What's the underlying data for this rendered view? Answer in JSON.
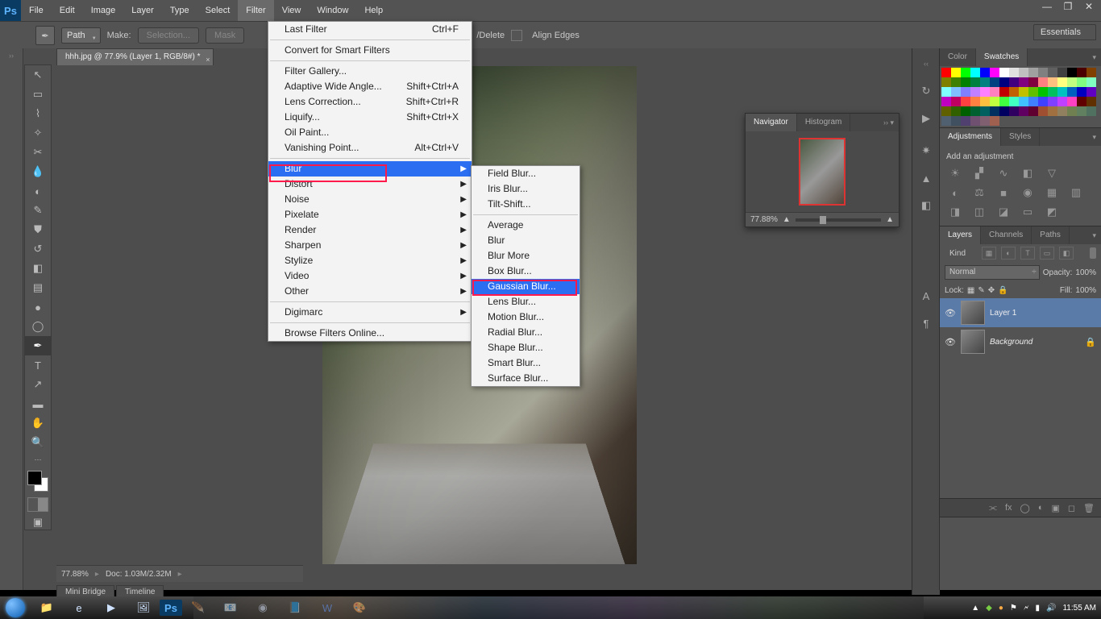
{
  "app": {
    "logo": "Ps"
  },
  "menu": {
    "items": [
      "File",
      "Edit",
      "Image",
      "Layer",
      "Type",
      "Select",
      "Filter",
      "View",
      "Window",
      "Help"
    ],
    "open_index": 6
  },
  "window_controls": {
    "min": "—",
    "max": "❐",
    "close": "✕"
  },
  "options_bar": {
    "mode": "Path",
    "make_label": "Make:",
    "btn_selection": "Selection...",
    "btn_mask": "Mask",
    "align_ops": "/Delete",
    "align_edges": "Align Edges",
    "essentials": "Essentials"
  },
  "document": {
    "tab": "hhh.jpg @ 77.9% (Layer 1, RGB/8#) *",
    "zoom": "77.88%",
    "doc_size": "Doc:  1.03M/2.32M"
  },
  "bridge_tabs": {
    "mini": "Mini Bridge",
    "timeline": "Timeline"
  },
  "filter_menu": {
    "items": [
      {
        "label": "Last Filter",
        "shortcut": "Ctrl+F"
      },
      {
        "sep": true
      },
      {
        "label": "Convert for Smart Filters"
      },
      {
        "sep": true
      },
      {
        "label": "Filter Gallery..."
      },
      {
        "label": "Adaptive Wide Angle...",
        "shortcut": "Shift+Ctrl+A"
      },
      {
        "label": "Lens Correction...",
        "shortcut": "Shift+Ctrl+R"
      },
      {
        "label": "Liquify...",
        "shortcut": "Shift+Ctrl+X"
      },
      {
        "label": "Oil Paint..."
      },
      {
        "label": "Vanishing Point...",
        "shortcut": "Alt+Ctrl+V"
      },
      {
        "sep": true
      },
      {
        "label": "Blur",
        "sub": true,
        "hl": true
      },
      {
        "label": "Distort",
        "sub": true
      },
      {
        "label": "Noise",
        "sub": true
      },
      {
        "label": "Pixelate",
        "sub": true
      },
      {
        "label": "Render",
        "sub": true
      },
      {
        "label": "Sharpen",
        "sub": true
      },
      {
        "label": "Stylize",
        "sub": true
      },
      {
        "label": "Video",
        "sub": true
      },
      {
        "label": "Other",
        "sub": true
      },
      {
        "sep": true
      },
      {
        "label": "Digimarc",
        "sub": true
      },
      {
        "sep": true
      },
      {
        "label": "Browse Filters Online..."
      }
    ]
  },
  "blur_submenu": {
    "items": [
      {
        "label": "Field Blur..."
      },
      {
        "label": "Iris Blur..."
      },
      {
        "label": "Tilt-Shift..."
      },
      {
        "sep": true
      },
      {
        "label": "Average"
      },
      {
        "label": "Blur"
      },
      {
        "label": "Blur More"
      },
      {
        "label": "Box Blur..."
      },
      {
        "label": "Gaussian Blur...",
        "hl": true
      },
      {
        "label": "Lens Blur..."
      },
      {
        "label": "Motion Blur..."
      },
      {
        "label": "Radial Blur..."
      },
      {
        "label": "Shape Blur..."
      },
      {
        "label": "Smart Blur..."
      },
      {
        "label": "Surface Blur..."
      }
    ]
  },
  "navigator": {
    "tab_nav": "Navigator",
    "tab_hist": "Histogram",
    "zoom": "77.88%"
  },
  "panels": {
    "color": {
      "t1": "Color",
      "t2": "Swatches"
    },
    "adjust": {
      "t1": "Adjustments",
      "t2": "Styles",
      "hint": "Add an adjustment"
    },
    "layers": {
      "t1": "Layers",
      "t2": "Channels",
      "t3": "Paths",
      "kind": "Kind",
      "blend": "Normal",
      "opacity_l": "Opacity:",
      "opacity_v": "100%",
      "lock_l": "Lock:",
      "fill_l": "Fill:",
      "fill_v": "100%",
      "layer1": "Layer 1",
      "bg": "Background"
    }
  },
  "swatch_colors": [
    "#ff0000",
    "#ffff00",
    "#00ff00",
    "#00ffff",
    "#0000ff",
    "#ff00ff",
    "#ffffff",
    "#e0e0e0",
    "#c0c0c0",
    "#a0a0a0",
    "#808080",
    "#606060",
    "#404040",
    "#000000",
    "#4a0000",
    "#804000",
    "#808000",
    "#408000",
    "#008000",
    "#008040",
    "#008080",
    "#004080",
    "#000080",
    "#400080",
    "#800080",
    "#800040",
    "#ff8080",
    "#ffc080",
    "#ffff80",
    "#c0ff80",
    "#80ff80",
    "#80ffc0",
    "#80ffff",
    "#80c0ff",
    "#8080ff",
    "#c080ff",
    "#ff80ff",
    "#ff80c0",
    "#c00000",
    "#c06000",
    "#c0c000",
    "#60c000",
    "#00c000",
    "#00c060",
    "#00c0c0",
    "#0060c0",
    "#0000c0",
    "#6000c0",
    "#c000c0",
    "#c00060",
    "#ff4040",
    "#ff8040",
    "#ffc040",
    "#c0ff40",
    "#40ff40",
    "#40ffc0",
    "#40c0ff",
    "#4080ff",
    "#4040ff",
    "#8040ff",
    "#c040ff",
    "#ff40c0",
    "#600000",
    "#603000",
    "#606000",
    "#306000",
    "#006000",
    "#006030",
    "#006060",
    "#003060",
    "#000060",
    "#300060",
    "#600060",
    "#600030",
    "#a05030",
    "#a07040",
    "#908060",
    "#708050",
    "#608060",
    "#507060",
    "#506070",
    "#405060",
    "#504070",
    "#705070",
    "#806070",
    "#a06050"
  ],
  "taskbar": {
    "time": "11:55 AM"
  }
}
